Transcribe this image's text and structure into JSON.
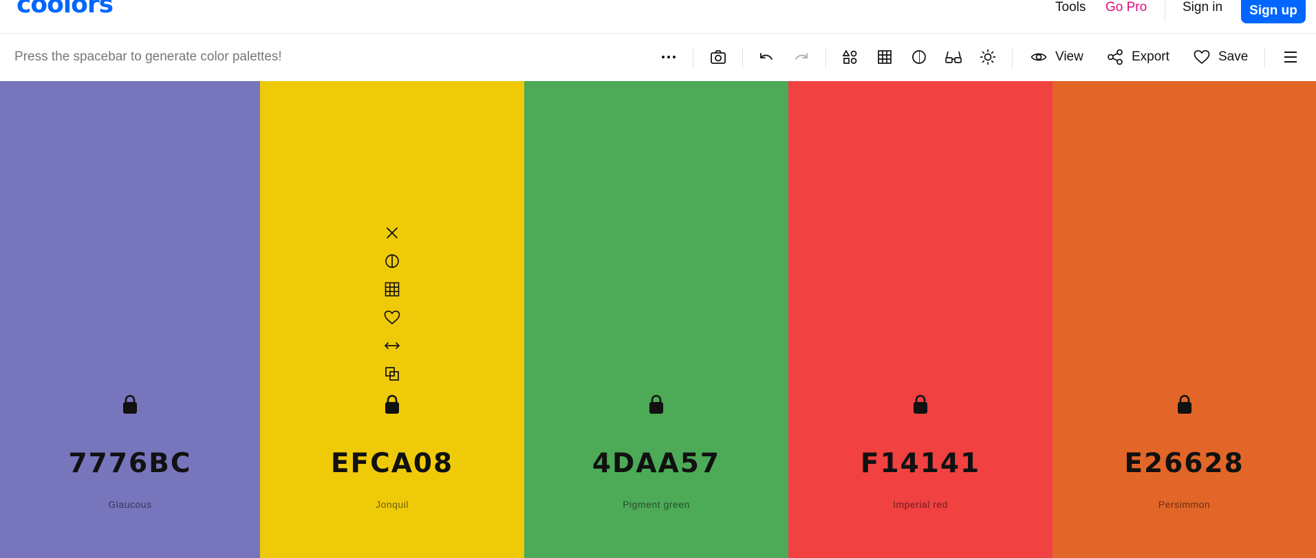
{
  "nav": {
    "logo": "coolors",
    "tools": "Tools",
    "go_pro": "Go Pro",
    "sign_in": "Sign in",
    "sign_up": "Sign up"
  },
  "toolbar": {
    "hint": "Press the spacebar to generate color palettes!",
    "view_label": "View",
    "export_label": "Export",
    "save_label": "Save"
  },
  "colors": {
    "c1": {
      "hex": "7776BC",
      "name": "Glaucous",
      "color": "#7776BC"
    },
    "c2": {
      "hex": "EFCA08",
      "name": "Jonquil",
      "color": "#EFCA08"
    },
    "c3": {
      "hex": "4DAA57",
      "name": "Pigment green",
      "color": "#4DAA57"
    },
    "c4": {
      "hex": "F14141",
      "name": "Imperial red",
      "color": "#F14141"
    },
    "c5": {
      "hex": "E26628",
      "name": "Persimmon",
      "color": "#E26628"
    }
  },
  "icons": {
    "toolbar": [
      "more-icon",
      "camera-icon",
      "undo-icon",
      "redo-icon",
      "shapes-icon",
      "grid-icon",
      "contrast-icon",
      "glasses-icon",
      "sun-icon",
      "eye-icon",
      "share-icon",
      "heart-icon",
      "menu-icon"
    ],
    "column_tools": [
      "close-icon",
      "contrast-icon",
      "grid-icon",
      "heart-icon",
      "drag-icon",
      "copy-icon",
      "lock-icon"
    ]
  },
  "brand_color": "#0066ff",
  "pro_color": "#e5077f"
}
